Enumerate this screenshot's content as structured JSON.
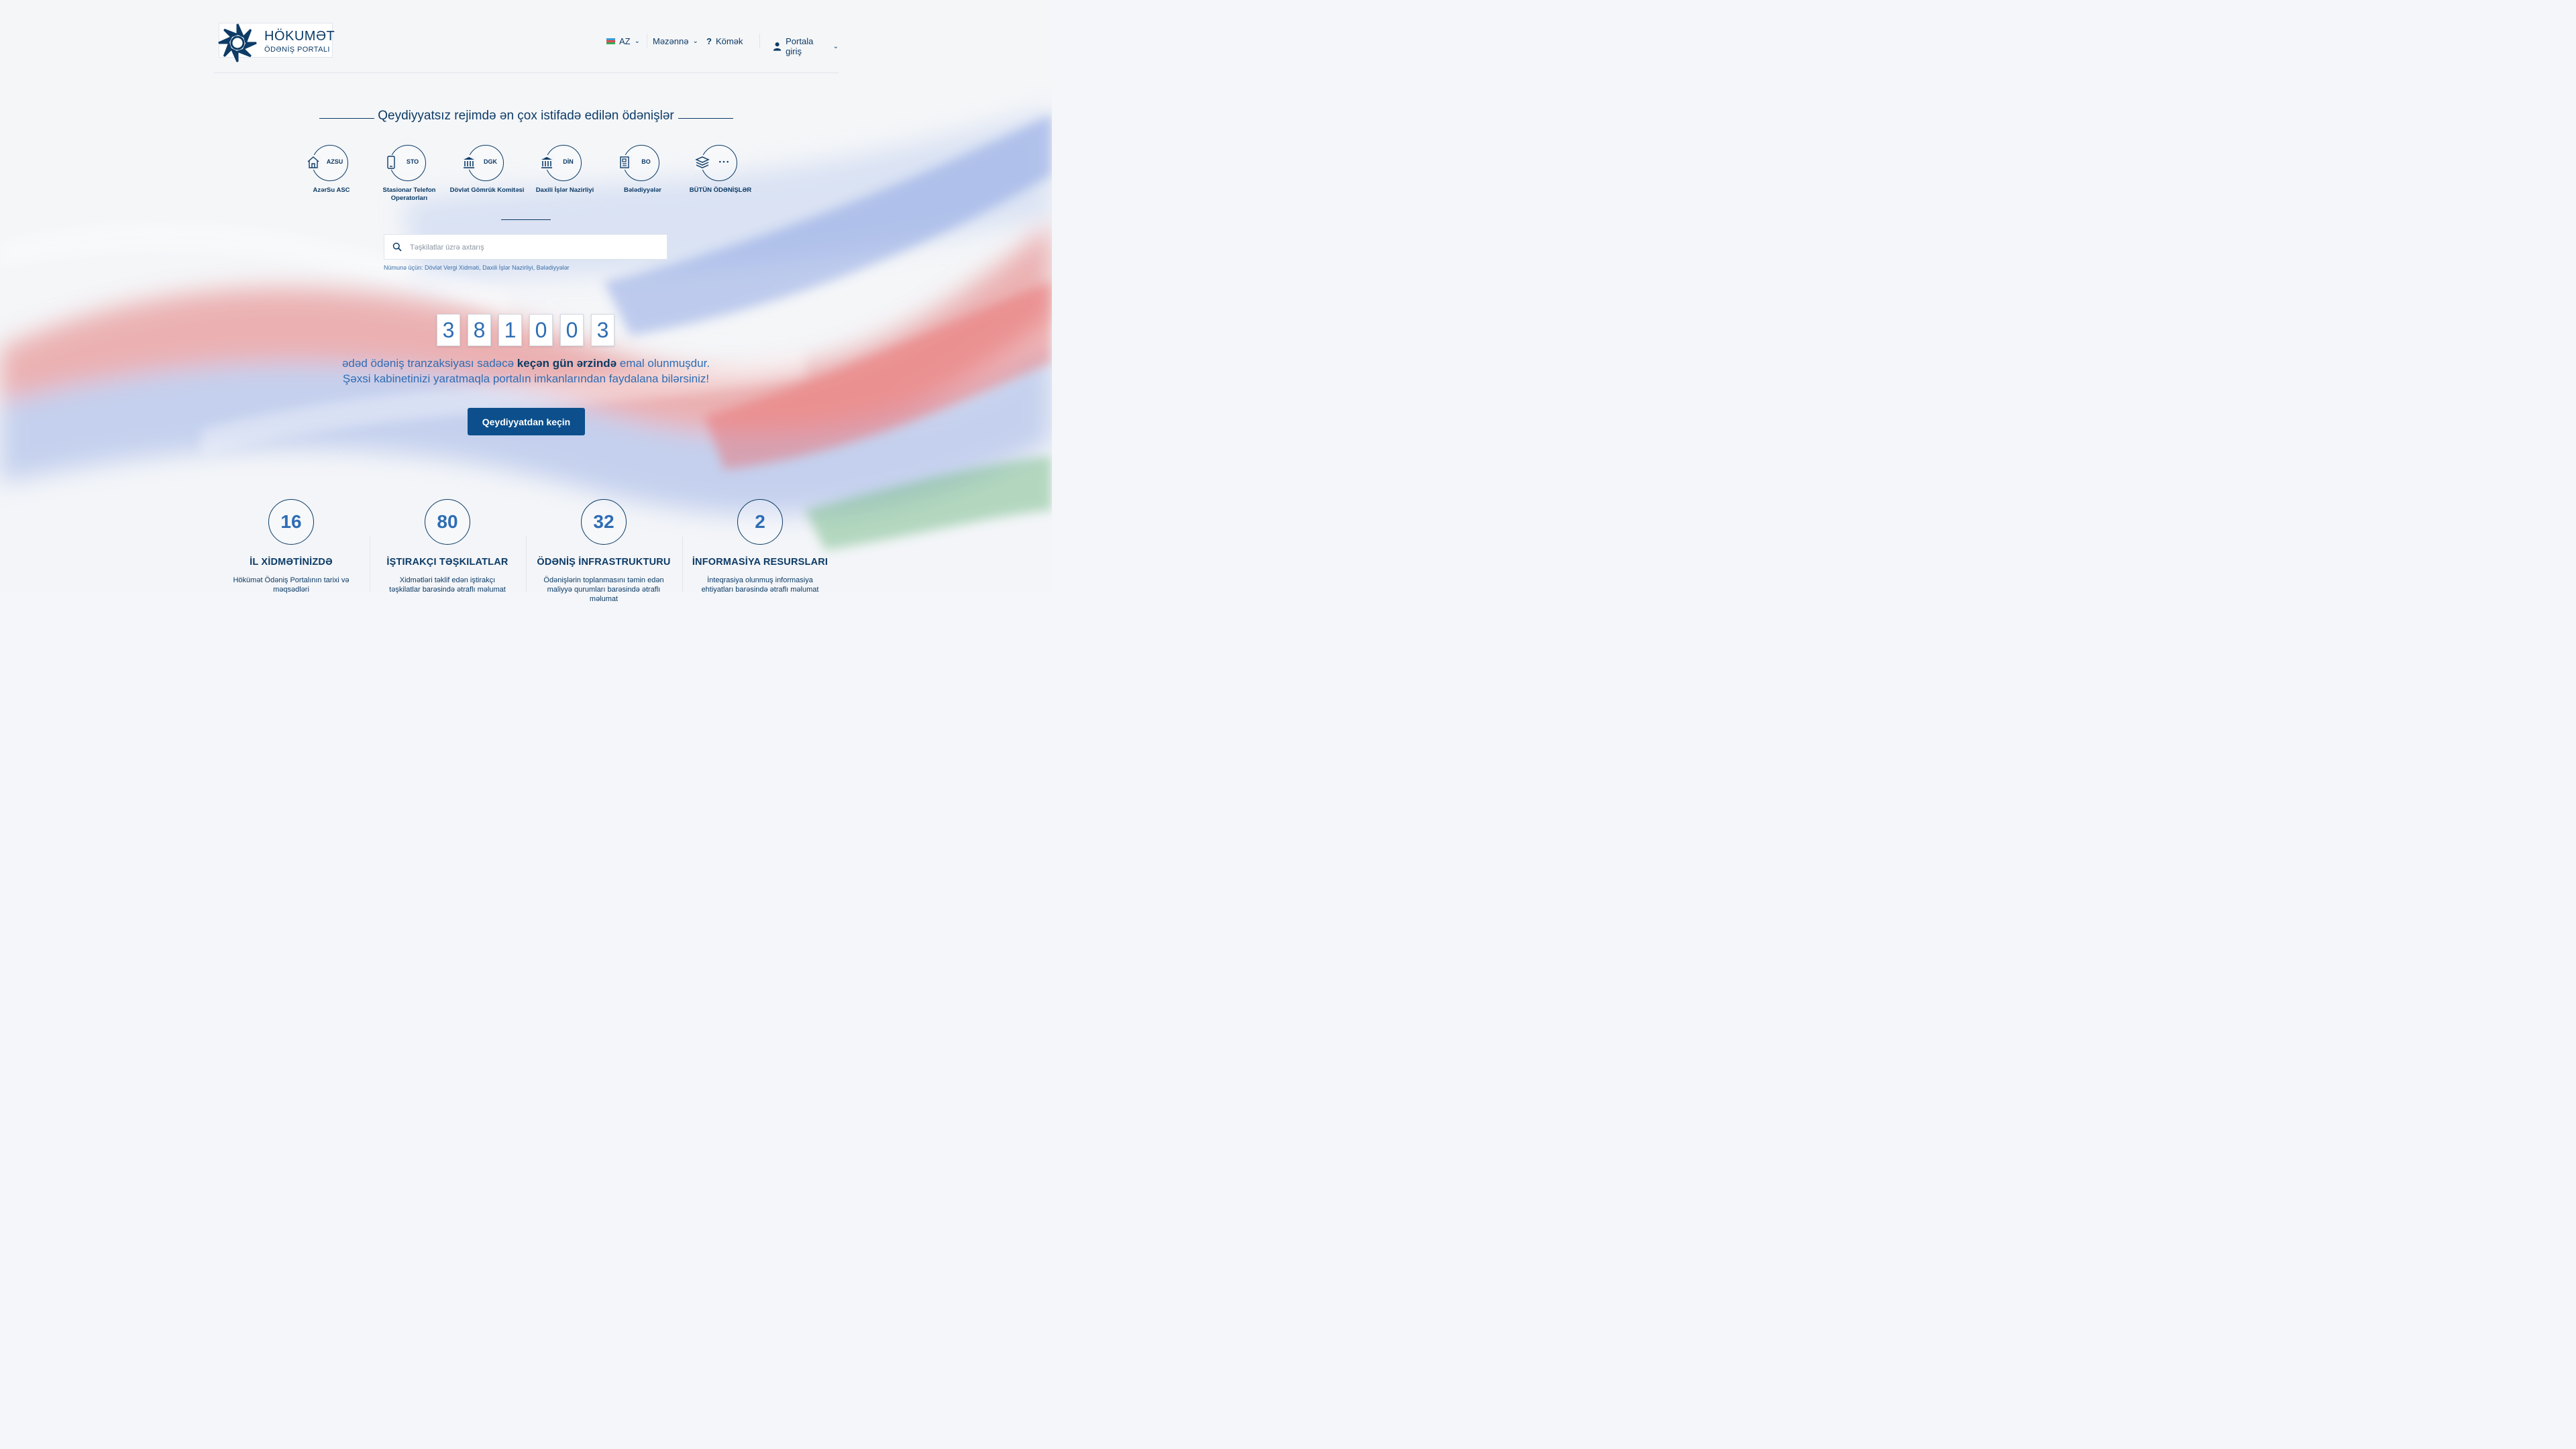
{
  "header": {
    "logo_line1": "HÖKUMƏT",
    "logo_line2": "ÖDƏNİŞ PORTALI",
    "language": "AZ",
    "menu": "Məzənnə",
    "help": "Kömək",
    "login": "Portala giriş"
  },
  "popular": {
    "title": "Qeydiyyatsız rejimdə ən çox istifadə edilən ödənişlər",
    "items": [
      {
        "abbr": "AZSU",
        "name": "AzərSu ASC",
        "icon": "house-icon"
      },
      {
        "abbr": "STO",
        "name": "Stasionar Telefon Operatorları",
        "icon": "phone-icon"
      },
      {
        "abbr": "DGK",
        "name": "Dövlət Gömrük Komitəsi",
        "icon": "building-columns-icon"
      },
      {
        "abbr": "DİN",
        "name": "Daxili İşlər Nazirliyi",
        "icon": "building-columns-icon"
      },
      {
        "abbr": "BO",
        "name": "Bələdiyyələr",
        "icon": "document-icon"
      },
      {
        "abbr": "• • •",
        "name": "BÜTÜN ÖDƏNİŞLƏR",
        "icon": "layers-icon"
      }
    ]
  },
  "search": {
    "placeholder": "Təşkilatlar üzrə axtarış",
    "example": "Nümunə üçün: Dövlət Vergi Xidməti, Daxili İşlər Nazirliyi, Bələdiyyələr"
  },
  "counter": {
    "digits": [
      "3",
      "8",
      "1",
      "0",
      "0",
      "3"
    ],
    "line1_pre": "ədəd ödəniş tranzaksiyası sadəcə",
    "line1_bold": "keçən gün ərzində",
    "line1_post": "emal olunmuşdur.",
    "line2": "Şəxsi kabinetinizi yaratmaqla portalın imkanlarından faydalana bilərsiniz!",
    "cta": "Qeydiyyatdan keçin"
  },
  "stats": [
    {
      "value": "16",
      "title": "İL XİDMƏTİNİZDƏ",
      "desc": "Hökümət Ödəniş Portalının tarixi və məqsədləri"
    },
    {
      "value": "80",
      "title": "İŞTIRAKÇI TƏŞKILATLAR",
      "desc": "Xidmətləri təklif edən iştirakçı təşkilatlar barəsində ətraflı məlumat"
    },
    {
      "value": "32",
      "title": "ÖDƏNİŞ İNFRASTRUKTURU",
      "desc": "Ödənişlərin toplanmasını təmin edən maliyyə qurumları barəsində ətraflı məlumat"
    },
    {
      "value": "2",
      "title": "İNFORMASİYA RESURSLARI",
      "desc": "İnteqrasiya olunmuş informasiya ehtiyatları barəsində ətraflı məlumat"
    }
  ],
  "colors": {
    "primary": "#0d3b66",
    "accent": "#2e6db4",
    "button": "#0c4f8c",
    "flag_blue": "#3a9ad9",
    "flag_red": "#e04b4b",
    "flag_green": "#3aa757"
  }
}
